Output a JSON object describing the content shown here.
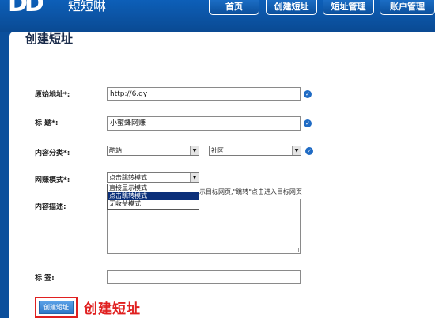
{
  "header": {
    "logo_mark": "DD",
    "logo_text": "短短啉",
    "nav": [
      "首页",
      "创建短址",
      "短址管理",
      "账户管理"
    ]
  },
  "form": {
    "title": "创建短址",
    "original_url": {
      "label": "原始地址*:",
      "value": "http://6.gy"
    },
    "title_field": {
      "label": "标 题*:",
      "value": "小蜜蜂网赚"
    },
    "category": {
      "label": "内容分类*:",
      "primary": "酷站",
      "secondary": "社区"
    },
    "earn_mode": {
      "label": "网赚模式*:",
      "value": "点击跳转模式",
      "options": [
        "直接显示模式",
        "点击跳转模式",
        "无收益模式"
      ],
      "selected_index": 1,
      "hint": "示目标网页,\"跳转\"点击进入目标网页"
    },
    "description": {
      "label": "内容描述:"
    },
    "tags": {
      "label": "标 签:",
      "value": ""
    },
    "submit_label": "创建短址"
  },
  "annotation": "创建短址",
  "colors": {
    "brand": "#0b4f9c",
    "check": "#1f6bc4",
    "highlight": "#e02020"
  }
}
